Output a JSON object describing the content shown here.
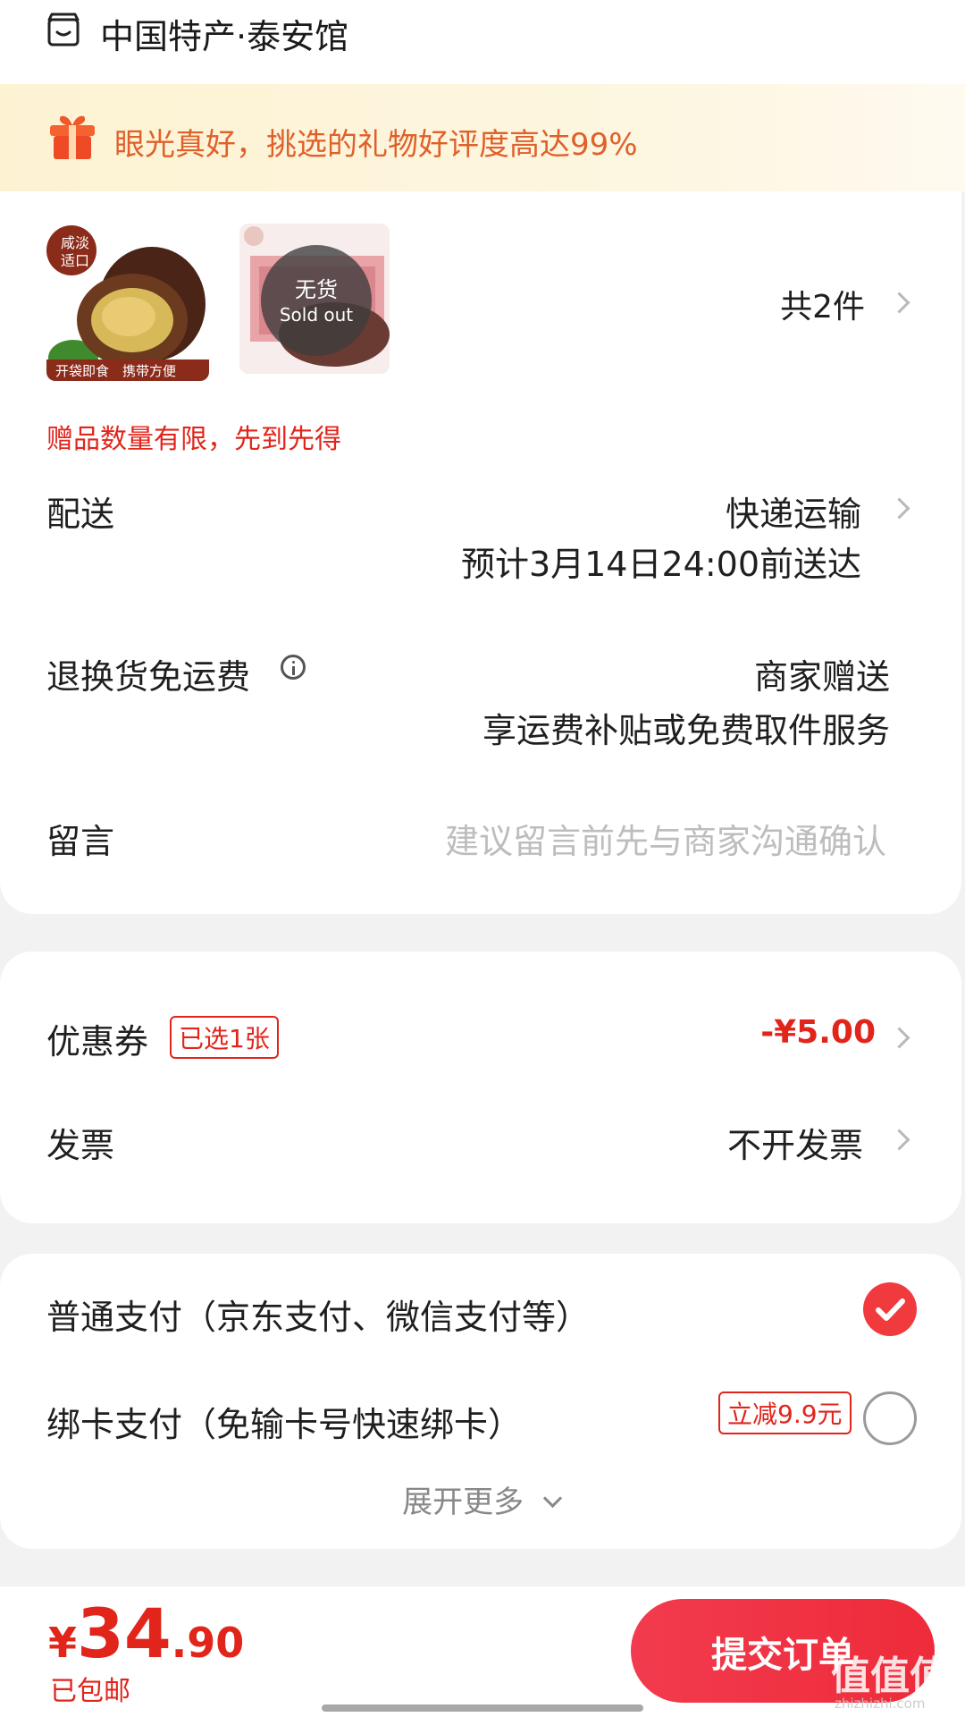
{
  "store": {
    "name": "中国特产·泰安馆"
  },
  "banner": {
    "text": "眼光真好，挑选的礼物好评度高达99%"
  },
  "products": {
    "item1": {
      "badge_line1": "咸淡",
      "badge_line2": "适口",
      "caption": "开袋即食　携带方便"
    },
    "item2": {
      "overlay_cn": "无货",
      "overlay_en": "Sold out"
    },
    "count_label": "共2件",
    "gift_note": "赠品数量有限，先到先得"
  },
  "delivery": {
    "label": "配送",
    "method": "快递运输",
    "eta": "预计3月14日24:00前送达"
  },
  "return_shipping": {
    "label": "退换货免运费",
    "value": "商家赠送",
    "desc": "享运费补贴或免费取件服务"
  },
  "message": {
    "label": "留言",
    "placeholder": "建议留言前先与商家沟通确认"
  },
  "coupon": {
    "label": "优惠券",
    "tag": "已选1张",
    "value": "-¥5.00"
  },
  "invoice": {
    "label": "发票",
    "value": "不开发票"
  },
  "payment": {
    "options": [
      {
        "label": "普通支付（京东支付、微信支付等）",
        "selected": true
      },
      {
        "label": "绑卡支付（免输卡号快速绑卡）",
        "promo": "立减9.9元",
        "selected": false
      }
    ],
    "more_label": "展开更多"
  },
  "footer": {
    "currency": "¥",
    "price_int": "34",
    "price_dec": ".90",
    "shipping_note": "已包邮",
    "submit_label": "提交订单"
  },
  "watermark": {
    "text": "值值值",
    "url_text": "zhizhizhi.com"
  },
  "colors": {
    "accent": "#e4393c",
    "price": "#e1251b",
    "banner_bg": "#fdf5dc",
    "banner_text": "#e0602a"
  }
}
